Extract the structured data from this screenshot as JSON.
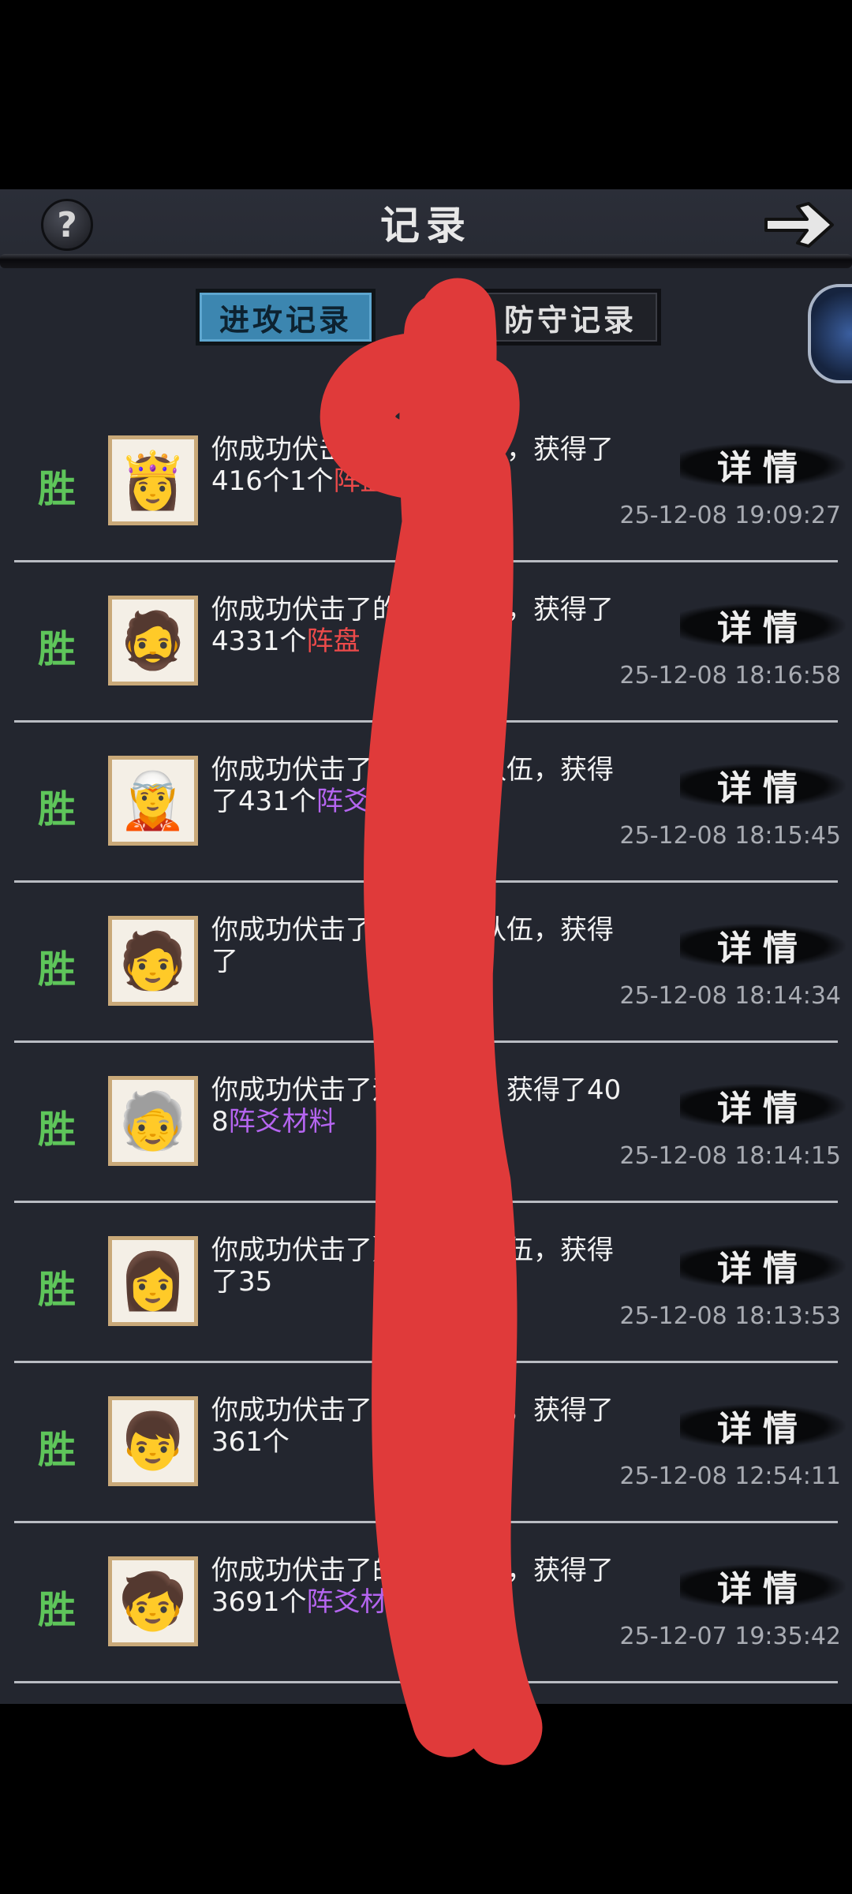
{
  "header": {
    "title": "记录",
    "help_glyph": "?",
    "back_icon": "arrow-right-icon"
  },
  "tabs": [
    {
      "label": "进攻记录",
      "active": true
    },
    {
      "label": "防守记录",
      "active": false
    }
  ],
  "colors": {
    "win": "#5ec55a",
    "item_red": "#ec4a4a",
    "item_purple": "#b565f0",
    "annotation": "#e03a3a"
  },
  "records": [
    {
      "result": "胜",
      "line1": "你成功伏击了",
      "line1_end": "的运镖队伍",
      "line2": "，获得了416个",
      "line2_end": "1个",
      "item": "阵盘",
      "item_color": "red",
      "detail_label": "详情",
      "time": "25-12-08 19:09:27"
    },
    {
      "result": "胜",
      "line1": "你成功伏击了",
      "line1_end": "的运镖队伍",
      "line2": "，获得了433",
      "line2_end": "1个",
      "item": "阵盘",
      "item_color": "red",
      "detail_label": "详情",
      "time": "25-12-08 18:16:58"
    },
    {
      "result": "胜",
      "line1": "你成功伏击了",
      "line1_end": "】的运镖队",
      "line2": "伍，获得了43",
      "line2_end": "1个",
      "item": "阵爻材料",
      "item_color": "purple",
      "detail_label": "详情",
      "time": "25-12-08 18:15:45"
    },
    {
      "result": "胜",
      "line1": "你成功伏击了",
      "line1_end": "】的运镖",
      "line2": "队伍，获得了",
      "line2_end": "",
      "item": "",
      "item_color": "",
      "detail_label": "详情",
      "time": "25-12-08 18:14:34"
    },
    {
      "result": "胜",
      "line1": "你成功伏击了",
      "line1_end": "运镖队伍",
      "line2": "，获得了408",
      "line2_end": "",
      "item": "阵爻材料",
      "item_color": "purple",
      "detail_label": "详情",
      "time": "25-12-08 18:14:15"
    },
    {
      "result": "胜",
      "line1": "你成功伏击了",
      "line1_end": "】的运镖队",
      "line2": "伍，获得了35",
      "line2_end": "",
      "item": "",
      "item_color": "",
      "detail_label": "详情",
      "time": "25-12-08 18:13:53"
    },
    {
      "result": "胜",
      "line1": "你成功伏击了",
      "line1_end": "的运镖队伍",
      "line2": "，获得了361个",
      "line2_end": "",
      "item": "",
      "item_color": "",
      "detail_label": "详情",
      "time": "25-12-08 12:54:11"
    },
    {
      "result": "胜",
      "line1": "你成功伏击了",
      "line1_end": "的运镖队",
      "line2": "伍，获得了369",
      "line2_end": "1个",
      "item": "阵爻材料",
      "item_color": "purple",
      "detail_label": "详情",
      "time": "25-12-07 19:35:42"
    }
  ]
}
